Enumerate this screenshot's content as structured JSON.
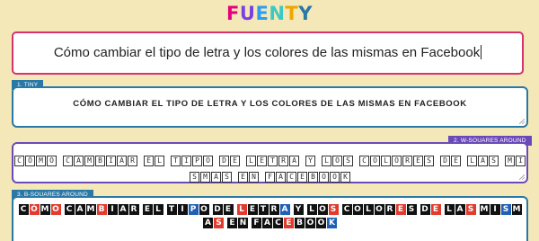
{
  "logo": {
    "letters": [
      "F",
      "U",
      "E",
      "N",
      "T",
      "Y"
    ],
    "colors": [
      "#e6007e",
      "#7b3fe4",
      "#2a9df4",
      "#3cc9c3",
      "#f0a500",
      "#2a78a6"
    ]
  },
  "main": {
    "text": "Cómo cambiar el tipo de letra y los colores de las mismas en Facebook"
  },
  "styles": [
    {
      "tag": "1. TINY",
      "tag_color": "#2a78a6",
      "text": "CÓMO CAMBIAR EL TIPO DE LETRA Y LOS COLORES DE LAS MISMAS EN FACEBOOK"
    },
    {
      "tag": "2. W-SQUARES AROUND",
      "tag_color": "#6a4ab8",
      "text": "CÓMO CAMBIAR EL TIPO DE LETRA Y LOS COLORES DE LAS MISMAS EN FACEBOOK"
    },
    {
      "tag": "3. B-SQUARES AROUND",
      "tag_color": "#2a78a6",
      "text": "CÓMO CAMBIAR EL TIPO DE LETRA Y LOS COLORES DE LAS MISMAS EN FACEBOOK"
    }
  ]
}
